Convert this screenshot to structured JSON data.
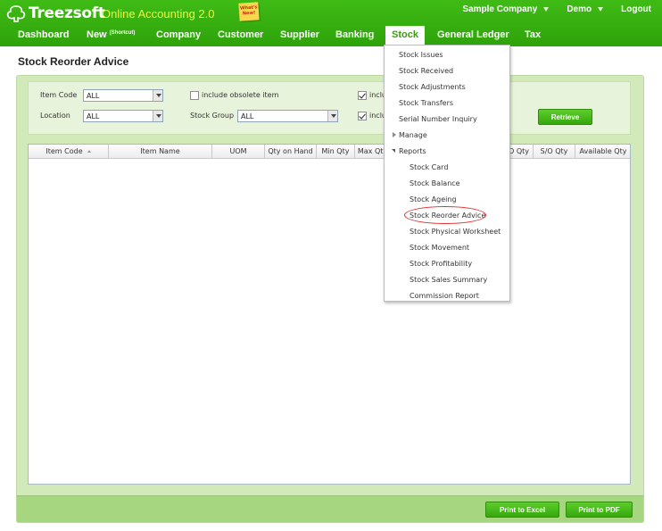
{
  "brand": {
    "name": "Treezsoft",
    "tagline": "Online Accounting 2.0",
    "whats_new": "What's New!"
  },
  "top_right": {
    "company": "Sample Company",
    "user": "Demo",
    "logout": "Logout"
  },
  "nav": {
    "items": [
      {
        "label": "Dashboard"
      },
      {
        "label": "New",
        "sup": "(Shortcut)"
      },
      {
        "label": "Company"
      },
      {
        "label": "Customer"
      },
      {
        "label": "Supplier"
      },
      {
        "label": "Banking"
      },
      {
        "label": "Stock",
        "active": true
      },
      {
        "label": "General Ledger"
      },
      {
        "label": "Tax"
      }
    ]
  },
  "page": {
    "title": "Stock Reorder Advice"
  },
  "filters": {
    "item_code_label": "Item Code",
    "item_code_value": "ALL",
    "location_label": "Location",
    "location_value": "ALL",
    "include_obsolete_label": "include obsolete item",
    "include_obsolete_checked": false,
    "stock_group_label": "Stock Group",
    "stock_group_value": "ALL",
    "include_1_label": "inclu",
    "include_1_checked": true,
    "include_2_label": "inclu",
    "include_2_checked": true,
    "retrieve_label": "Retrieve"
  },
  "grid": {
    "columns": [
      {
        "label": "Item Code",
        "sortable": true
      },
      {
        "label": "Item Name"
      },
      {
        "label": "UOM"
      },
      {
        "label": "Qty on Hand"
      },
      {
        "label": "Min Qty"
      },
      {
        "label": "Max Qty"
      },
      {
        "label": "O Qty"
      },
      {
        "label": "S/O Qty"
      },
      {
        "label": "Available Qty"
      }
    ],
    "rows": []
  },
  "actions": {
    "print_excel": "Print to Excel",
    "print_pdf": "Print to PDF"
  },
  "stock_menu": {
    "items": [
      {
        "label": "Stock Issues"
      },
      {
        "label": "Stock Received"
      },
      {
        "label": "Stock Adjustments"
      },
      {
        "label": "Stock Transfers"
      },
      {
        "label": "Serial Number Inquiry"
      }
    ],
    "manage_label": "Manage",
    "reports_label": "Reports",
    "reports": [
      {
        "label": "Stock Card"
      },
      {
        "label": "Stock Balance"
      },
      {
        "label": "Stock Ageing"
      },
      {
        "label": "Stock Reorder Advice",
        "highlighted": true
      },
      {
        "label": "Stock Physical Worksheet"
      },
      {
        "label": "Stock Movement"
      },
      {
        "label": "Stock Profitability"
      },
      {
        "label": "Stock Sales Summary"
      },
      {
        "label": "Commission Report"
      }
    ]
  },
  "colors": {
    "header_green": "#36ac0f",
    "tagline_yellow": "#f1f740",
    "panel_green": "#d2eaba",
    "button_green": "#45b81a",
    "highlight_red": "#e03030"
  }
}
